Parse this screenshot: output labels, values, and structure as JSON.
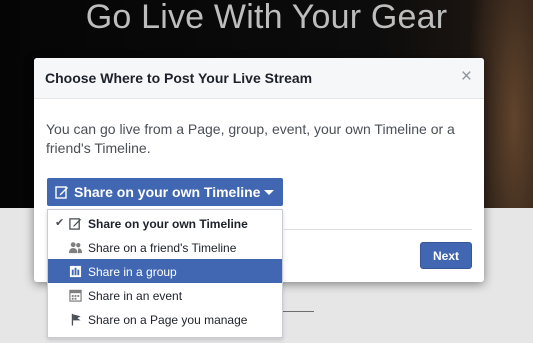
{
  "background": {
    "heading": "Go Live With Your Gear"
  },
  "modal": {
    "title": "Choose Where to Post Your Live Stream",
    "close_label": "×",
    "description": "You can go live from a Page, group, event, your own Timeline or a friend's Timeline.",
    "next_label": "Next",
    "accent_color": "#4267b2"
  },
  "dropdown": {
    "selected_label": "Share on your own Timeline",
    "selected_icon": "edit-icon",
    "items": [
      {
        "label": "Share on your own Timeline",
        "icon": "edit-icon",
        "checked": true,
        "highlighted": false
      },
      {
        "label": "Share on a friend's Timeline",
        "icon": "friends-icon",
        "checked": false,
        "highlighted": false
      },
      {
        "label": "Share in a group",
        "icon": "group-icon",
        "checked": false,
        "highlighted": true
      },
      {
        "label": "Share in an event",
        "icon": "calendar-icon",
        "checked": false,
        "highlighted": false
      },
      {
        "label": "Share on a Page you manage",
        "icon": "flag-icon",
        "checked": false,
        "highlighted": false
      }
    ]
  }
}
